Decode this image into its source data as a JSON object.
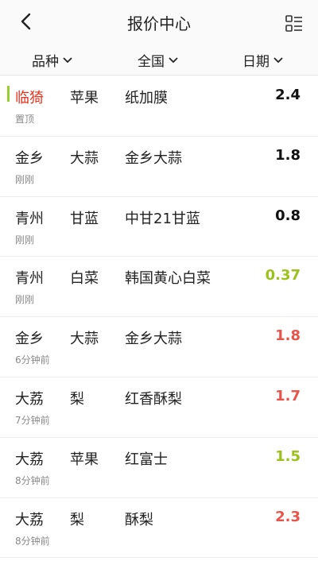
{
  "header": {
    "title": "报价中心"
  },
  "filters": [
    {
      "label": "品种"
    },
    {
      "label": "全国"
    },
    {
      "label": "日期"
    }
  ],
  "colors": {
    "pinned_origin": "#e8321e",
    "pin_marker": "#9acd32",
    "price_neutral": "#111111",
    "price_down": "#9ac21b",
    "price_up": "#e8544a"
  },
  "rows": [
    {
      "origin": "临猗",
      "product": "苹果",
      "variety": "纸加膜",
      "price": "2.4",
      "time": "置顶",
      "price_color": "#111111"
    },
    {
      "origin": "金乡",
      "product": "大蒜",
      "variety": "金乡大蒜",
      "price": "1.8",
      "time": "刚刚",
      "price_color": "#111111"
    },
    {
      "origin": "青州",
      "product": "甘蓝",
      "variety": "中甘21甘蓝",
      "price": "0.8",
      "time": "刚刚",
      "price_color": "#111111"
    },
    {
      "origin": "青州",
      "product": "白菜",
      "variety": "韩国黄心白菜",
      "price": "0.37",
      "time": "刚刚",
      "price_color": "#9ac21b"
    },
    {
      "origin": "金乡",
      "product": "大蒜",
      "variety": "金乡大蒜",
      "price": "1.8",
      "time": "6分钟前",
      "price_color": "#e8544a"
    },
    {
      "origin": "大荔",
      "product": "梨",
      "variety": "红香酥梨",
      "price": "1.7",
      "time": "7分钟前",
      "price_color": "#e8544a"
    },
    {
      "origin": "大荔",
      "product": "苹果",
      "variety": "红富士",
      "price": "1.5",
      "time": "8分钟前",
      "price_color": "#9ac21b"
    },
    {
      "origin": "大荔",
      "product": "梨",
      "variety": "酥梨",
      "price": "2.3",
      "time": "8分钟前",
      "price_color": "#e8544a"
    }
  ]
}
